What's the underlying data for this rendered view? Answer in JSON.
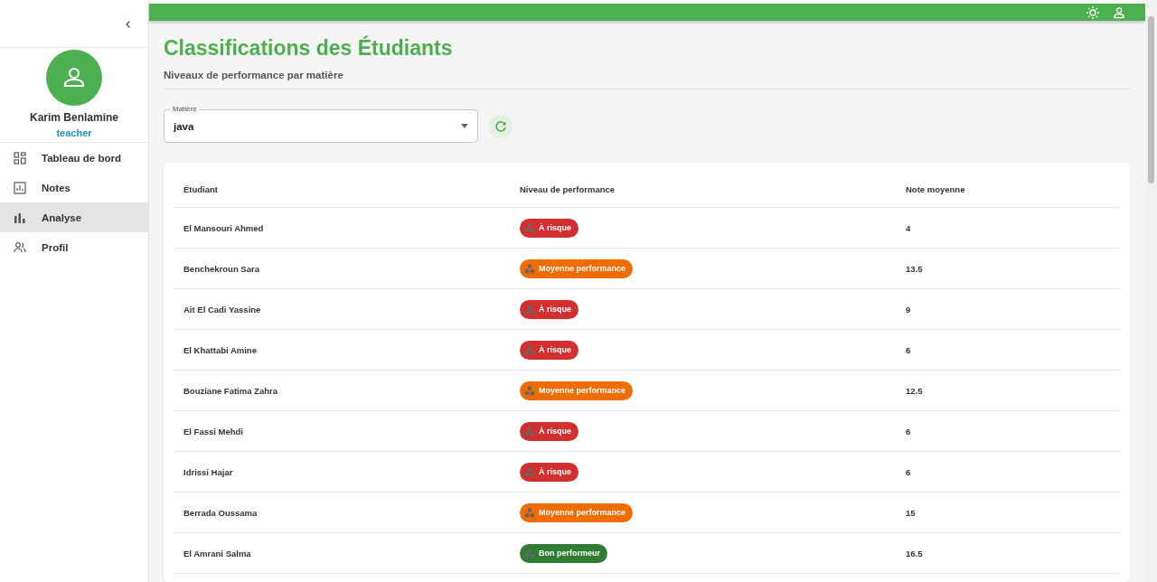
{
  "sidebar": {
    "user": {
      "name": "Karim Benlamine",
      "role": "teacher"
    },
    "items": [
      {
        "label": "Tableau de bord",
        "kind": "grid",
        "selected": false
      },
      {
        "label": "Notes",
        "kind": "chart",
        "selected": false
      },
      {
        "label": "Analyse",
        "kind": "bars",
        "selected": true
      },
      {
        "label": "Profil",
        "kind": "people",
        "selected": false
      }
    ]
  },
  "page": {
    "title": "Classifications des Étudiants",
    "subtitle": "Niveaux de performance par matière"
  },
  "subject_select": {
    "label": "Matière",
    "value": "java"
  },
  "table": {
    "columns": [
      "Étudiant",
      "Niveau de performance",
      "Note moyenne"
    ],
    "rows": [
      {
        "student": "El Mansouri Ahmed",
        "level": {
          "label": "À risque",
          "kind": "risk"
        },
        "average": "4"
      },
      {
        "student": "Benchekroun Sara",
        "level": {
          "label": "Moyenne performance",
          "kind": "average"
        },
        "average": "13.5"
      },
      {
        "student": "Ait El Cadi Yassine",
        "level": {
          "label": "À risque",
          "kind": "risk"
        },
        "average": "9"
      },
      {
        "student": "El Khattabi Amine",
        "level": {
          "label": "À risque",
          "kind": "risk"
        },
        "average": "6"
      },
      {
        "student": "Bouziane Fatima Zahra",
        "level": {
          "label": "Moyenne performance",
          "kind": "average"
        },
        "average": "12.5"
      },
      {
        "student": "El Fassi Mehdi",
        "level": {
          "label": "À risque",
          "kind": "risk"
        },
        "average": "6"
      },
      {
        "student": "Idrissi Hajar",
        "level": {
          "label": "À risque",
          "kind": "risk"
        },
        "average": "6"
      },
      {
        "student": "Berrada Oussama",
        "level": {
          "label": "Moyenne performance",
          "kind": "average"
        },
        "average": "15"
      },
      {
        "student": "El Amrani Salma",
        "level": {
          "label": "Bon performeur",
          "kind": "good"
        },
        "average": "16.5"
      }
    ]
  }
}
